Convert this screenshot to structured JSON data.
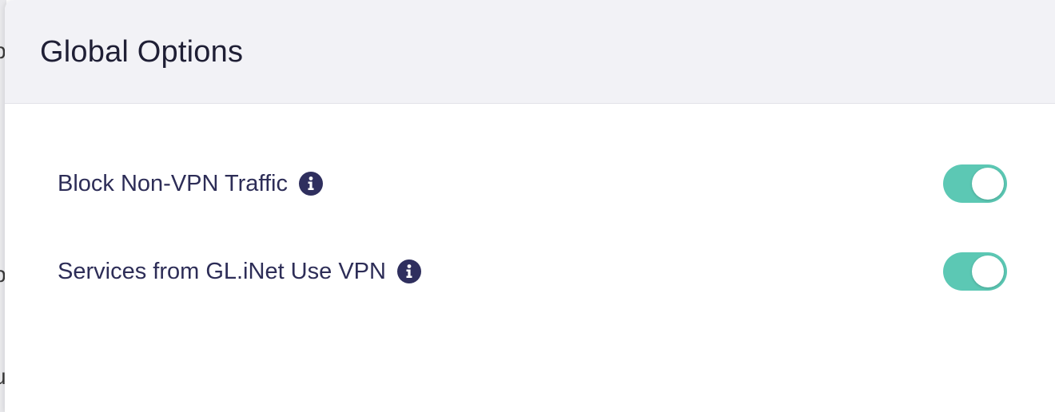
{
  "dialog": {
    "title": "Global Options"
  },
  "options": [
    {
      "label": "Block Non-VPN Traffic",
      "enabled": true,
      "icon": "info-icon"
    },
    {
      "label": "Services from GL.iNet Use VPN",
      "enabled": true,
      "icon": "info-icon"
    }
  ],
  "colors": {
    "toggle_on": "#5cc8b4",
    "text": "#2d2d57",
    "header_bg": "#f2f2f6"
  }
}
